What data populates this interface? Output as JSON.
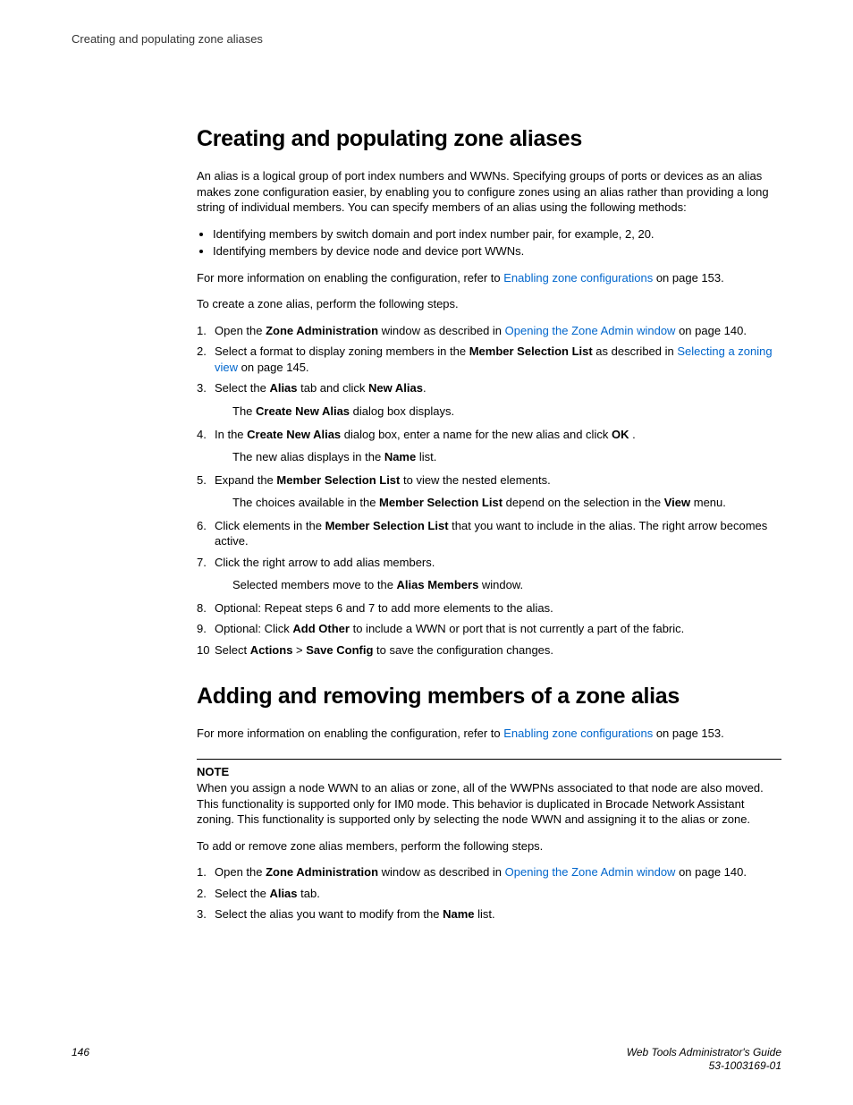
{
  "running_header": "Creating and populating zone aliases",
  "h1_a": "Creating and populating zone aliases",
  "intro_a": "An alias is a logical group of port index numbers and WWNs. Specifying groups of ports or devices as an alias makes zone configuration easier, by enabling you to configure zones using an alias rather than providing a long string of individual members. You can specify members of an alias using the following methods:",
  "bullets_a1": "Identifying members by switch domain and port index number pair, for example, 2, 20.",
  "bullets_a2": "Identifying members by device node and device port WWNs.",
  "info_a_pre": "For more information on enabling the configuration, refer to ",
  "link_enabling": "Enabling zone configurations",
  "info_a_post": " on page 153.",
  "lead_a": "To create a zone alias, perform the following steps.",
  "s1_pre": "Open the ",
  "s1_b1": "Zone Administration",
  "s1_mid": " window as described in ",
  "s1_link": "Opening the Zone Admin window",
  "s1_post": " on page 140.",
  "s2_pre": "Select a format to display zoning members in the ",
  "s2_b1": "Member Selection List",
  "s2_mid": " as described in ",
  "s2_link": "Selecting a zoning view",
  "s2_post": " on page 145.",
  "s3_pre": "Select the ",
  "s3_b1": "Alias",
  "s3_mid": " tab and click ",
  "s3_b2": "New Alias",
  "s3_post": ".",
  "s3_sub_pre": "The ",
  "s3_sub_b": "Create New Alias",
  "s3_sub_post": " dialog box displays.",
  "s4_pre": "In the ",
  "s4_b1": "Create New Alias",
  "s4_mid": " dialog box, enter a name for the new alias and click ",
  "s4_b2": "OK",
  "s4_post": " .",
  "s4_sub_pre": "The new alias displays in the ",
  "s4_sub_b": "Name",
  "s4_sub_post": " list.",
  "s5_pre": "Expand the ",
  "s5_b1": "Member Selection List",
  "s5_post": " to view the nested elements.",
  "s5_sub_pre": "The choices available in the ",
  "s5_sub_b1": "Member Selection List",
  "s5_sub_mid": " depend on the selection in the ",
  "s5_sub_b2": "View",
  "s5_sub_post": " menu.",
  "s6_pre": "Click elements in the ",
  "s6_b1": "Member Selection List",
  "s6_post": " that you want to include in the alias. The right arrow becomes active.",
  "s7": "Click the right arrow to add alias members.",
  "s7_sub_pre": "Selected members move to the ",
  "s7_sub_b": "Alias Members",
  "s7_sub_post": " window.",
  "s8": "Optional: Repeat steps 6 and 7 to add more elements to the alias.",
  "s9_pre": "Optional: Click ",
  "s9_b1": "Add Other",
  "s9_post": " to include a WWN or port that is not currently a part of the fabric.",
  "s10_pre": "Select ",
  "s10_b1": "Actions ",
  "s10_mid": " > ",
  "s10_b2": "Save Config",
  "s10_post": " to save the configuration changes.",
  "h1_b": "Adding and removing members of a zone alias",
  "info_b_pre": "For more information on enabling the configuration, refer to ",
  "info_b_post": " on page 153.",
  "note_label": "NOTE",
  "note_body": "When you assign a node WWN to an alias or zone, all of the WWPNs associated to that node are also moved. This functionality is supported only for IM0 mode. This behavior is duplicated in Brocade Network Assistant zoning. This functionality is supported only by selecting the node WWN and assigning it to the alias or zone.",
  "lead_b": "To add or remove zone alias members, perform the following steps.",
  "b1_pre": "Open the ",
  "b1_b1": "Zone Administration",
  "b1_mid": " window as described in ",
  "b1_link": "Opening the Zone Admin window",
  "b1_post": " on page 140.",
  "b2_pre": "Select the ",
  "b2_b1": "Alias",
  "b2_post": " tab.",
  "b3_pre": "Select the alias you want to modify from the ",
  "b3_b1": "Name",
  "b3_post": " list.",
  "footer_page": "146",
  "footer_title": "Web Tools Administrator's Guide",
  "footer_docnum": "53-1003169-01"
}
